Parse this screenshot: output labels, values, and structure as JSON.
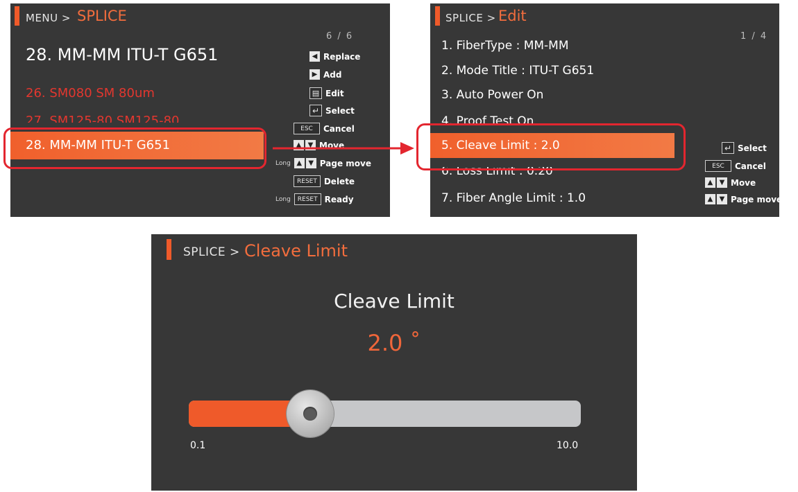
{
  "panel_menu": {
    "crumb_small": "MENU >",
    "crumb_big": "SPLICE",
    "page_indicator": "6 / 6",
    "current_title": "28. MM-MM ITU-T G651",
    "items": [
      {
        "label": "26. SM080 SM 80um"
      },
      {
        "label": "27. SM125-80 SM125-80"
      },
      {
        "label": "28. MM-MM ITU-T G651"
      }
    ],
    "hints": [
      {
        "key": "◀",
        "label": "Replace"
      },
      {
        "key": "▶",
        "label": "Add"
      },
      {
        "key": "▤",
        "label": "Edit"
      },
      {
        "key": "↵",
        "label": "Select"
      },
      {
        "key": "ESC",
        "label": "Cancel"
      },
      {
        "key": "▲▼",
        "label": "Move"
      },
      {
        "prefix": "Long",
        "key": "▲▼",
        "label": "Page move"
      },
      {
        "key": "RESET",
        "label": "Delete"
      },
      {
        "prefix": "Long",
        "key": "RESET",
        "label": "Ready"
      }
    ]
  },
  "panel_edit": {
    "crumb_small": "SPLICE >",
    "crumb_big": "Edit",
    "page_indicator": "1 / 4",
    "items": [
      {
        "label": "1. FiberType : MM-MM"
      },
      {
        "label": "2. Mode Title : ITU-T G651"
      },
      {
        "label": "3. Auto Power   On"
      },
      {
        "label": "4. Proof Test   On"
      },
      {
        "label": "5. Cleave Limit : 2.0"
      },
      {
        "label": "6. Loss Limit : 0.20"
      },
      {
        "label": "7. Fiber Angle Limit : 1.0"
      }
    ],
    "hints": [
      {
        "key": "↵",
        "label": "Select"
      },
      {
        "key": "ESC",
        "label": "Cancel"
      },
      {
        "key": "▲▼",
        "label": "Move"
      },
      {
        "key": "▲▼",
        "label": "Page move"
      }
    ]
  },
  "panel_cleave": {
    "crumb_small": "SPLICE >",
    "crumb_big": "Cleave Limit",
    "title": "Cleave Limit",
    "value": "2.0 ˚",
    "slider": {
      "min": 0.1,
      "max": 10.0,
      "value": 2.0,
      "min_label": "0.1",
      "max_label": "10.0"
    }
  },
  "colors": {
    "accent": "#ef5a2a",
    "screen_bg": "#373737",
    "highlight_box": "#e3262f",
    "red_text": "#e3372f"
  }
}
